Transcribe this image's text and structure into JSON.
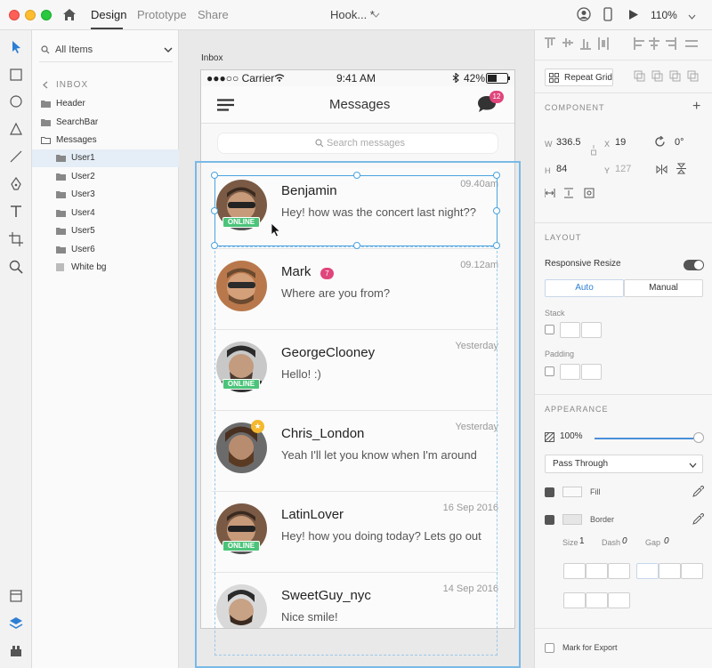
{
  "titlebar": {
    "tabs": [
      "Design",
      "Prototype",
      "Share"
    ],
    "active_tab": "Design",
    "doc_title": "Hook... *",
    "zoom": "110%"
  },
  "layers": {
    "search_value": "All Items",
    "back_label": "INBOX",
    "items": [
      {
        "label": "Header"
      },
      {
        "label": "SearchBar"
      },
      {
        "label": "Messages"
      },
      {
        "label": "User1"
      },
      {
        "label": "User2"
      },
      {
        "label": "User3"
      },
      {
        "label": "User4"
      },
      {
        "label": "User5"
      },
      {
        "label": "User6"
      },
      {
        "label": "White bg"
      }
    ]
  },
  "canvas": {
    "artboard_label": "Inbox",
    "status": {
      "carrier": "●●●○○ Carrier",
      "time": "9:41 AM",
      "battery": "42%"
    },
    "nav_title": "Messages",
    "chat_badge": "12",
    "search_placeholder": "Search messages",
    "online_label": "ONLINE",
    "messages": [
      {
        "name": "Benjamin",
        "text": "Hey! how was the concert last night??",
        "time": "09.40am"
      },
      {
        "name": "Mark",
        "text": "Where are you from?",
        "time": "09.12am",
        "badge": "7"
      },
      {
        "name": "GeorgeClooney",
        "text": "Hello! :)",
        "time": "Yesterday"
      },
      {
        "name": "Chris_London",
        "text": "Yeah I'll let you know when I'm around",
        "time": "Yesterday"
      },
      {
        "name": "LatinLover",
        "text": "Hey! how you doing today? Lets go out",
        "time": "16 Sep 2016"
      },
      {
        "name": "SweetGuy_nyc",
        "text": "Nice smile!",
        "time": "14 Sep 2016"
      }
    ]
  },
  "props": {
    "repeat_grid": "Repeat Grid",
    "component_title": "COMPONENT",
    "w_label": "W",
    "w": "336.5",
    "x_label": "X",
    "x": "19",
    "rotation": "0°",
    "h_label": "H",
    "h": "84",
    "y_label": "Y",
    "y": "127",
    "layout_title": "LAYOUT",
    "responsive_resize": "Responsive Resize",
    "auto": "Auto",
    "manual": "Manual",
    "stack": "Stack",
    "padding": "Padding",
    "appearance_title": "APPEARANCE",
    "opacity": "100%",
    "blend": "Pass Through",
    "fill": "Fill",
    "border": "Border",
    "size_label": "Size",
    "size": "1",
    "dash_label": "Dash",
    "dash": "0",
    "gap_label": "Gap",
    "gap": "0",
    "export": "Mark for Export",
    "accent": "#4a90d9"
  }
}
